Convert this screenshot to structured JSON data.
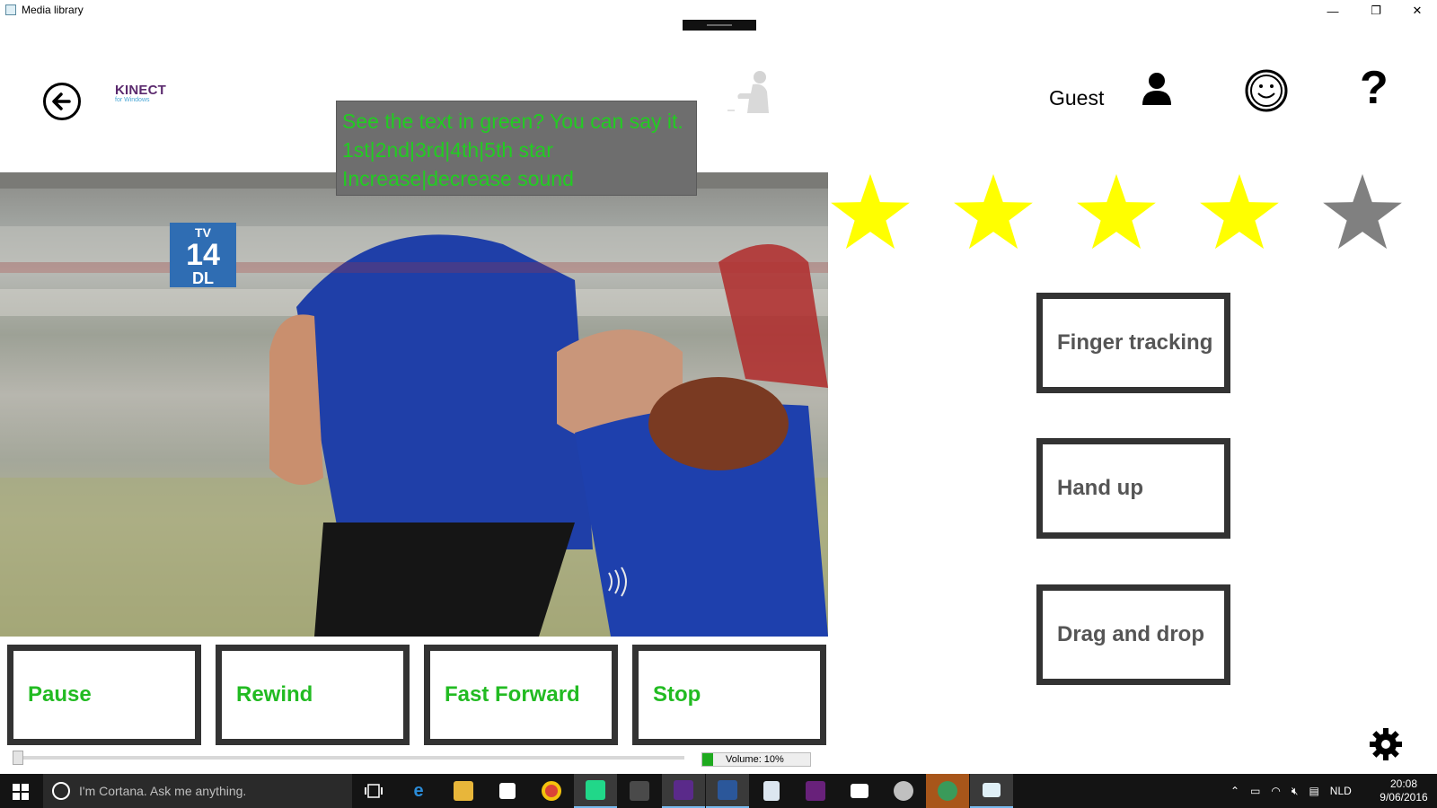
{
  "window": {
    "title": "Media library",
    "controls": {
      "minimize": "—",
      "restore": "❐",
      "close": "✕"
    }
  },
  "header": {
    "back_icon": "arrow-left-icon",
    "logo": {
      "word": "KINECT",
      "sub": "for Windows"
    },
    "user_label": "Guest",
    "help_label": "?"
  },
  "voice_hint": {
    "lines": [
      "See the text in green? You can say it.",
      "1st|2nd|3rd|4th|5th star",
      "Increase|decrease sound"
    ],
    "color": "#22cc22"
  },
  "video": {
    "rating_badge": {
      "top": "TV",
      "age": "14",
      "bottom": "DL"
    }
  },
  "rating": {
    "stars_total": 5,
    "stars_filled": 4,
    "filled_color": "#ffff00",
    "empty_color": "#808080"
  },
  "controls": {
    "pause": "Pause",
    "rewind": "Rewind",
    "fast_forward": "Fast Forward",
    "stop": "Stop",
    "label_color": "#22bb22"
  },
  "gestures": {
    "finger_tracking": "Finger tracking",
    "hand_up": "Hand up",
    "drag_and_drop": "Drag and drop"
  },
  "playback": {
    "progress": 0.0
  },
  "volume": {
    "label": "Volume: 10%",
    "level": 0.1
  },
  "taskbar": {
    "search_placeholder": "I'm Cortana. Ask me anything.",
    "language": "NLD",
    "time": "20:08",
    "date": "9/06/2016"
  }
}
